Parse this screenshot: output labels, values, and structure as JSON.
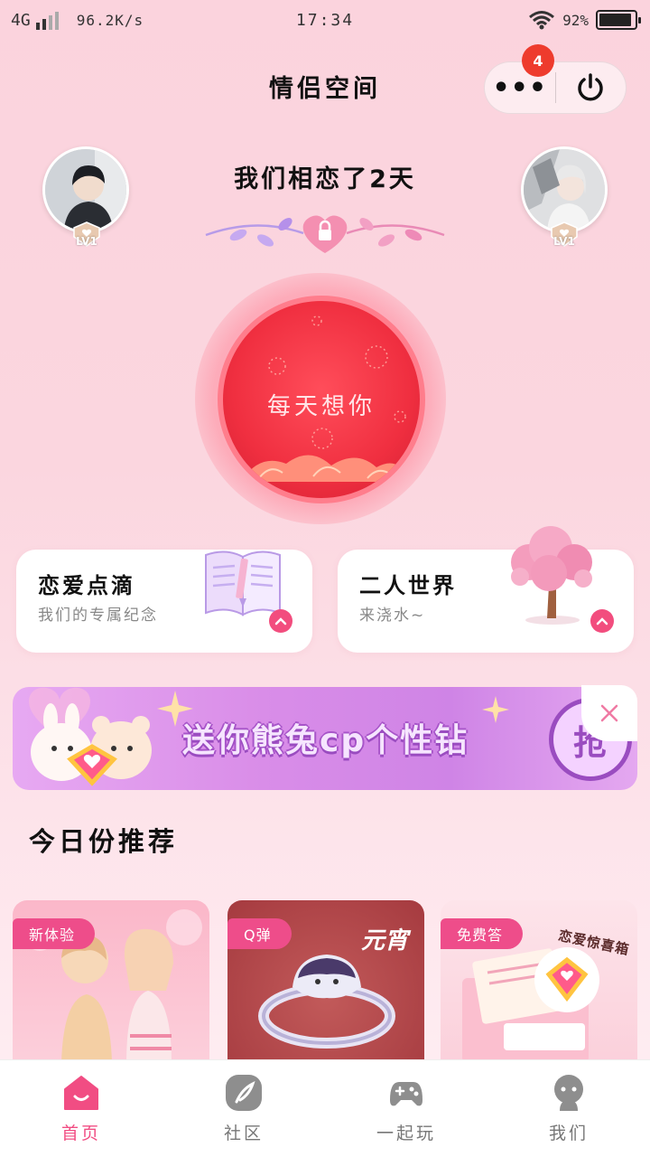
{
  "status_bar": {
    "network": "4G",
    "speed": "96.2K/s",
    "time": "17:34",
    "battery": "92%",
    "battery_level": 0.92
  },
  "header": {
    "title": "情侣空间",
    "notification_count": "4"
  },
  "couple": {
    "days_text": "我们相恋了2天",
    "left_level": "LV1",
    "right_level": "LV1"
  },
  "daily": {
    "label": "每天想你"
  },
  "cards": [
    {
      "title": "恋爱点滴",
      "subtitle": "我们的专属纪念"
    },
    {
      "title": "二人世界",
      "subtitle": "来浇水~"
    }
  ],
  "banner": {
    "text": "送你熊兔cp个性钻",
    "action": "抢"
  },
  "recommend": {
    "title": "今日份推荐",
    "items": [
      {
        "tag": "新体验"
      },
      {
        "tag": "Q弹",
        "art_text": "元宵"
      },
      {
        "tag": "免费答",
        "art_text": "恋爱惊喜箱"
      }
    ]
  },
  "tabbar": [
    {
      "label": "首页",
      "active": true
    },
    {
      "label": "社区"
    },
    {
      "label": "一起玩"
    },
    {
      "label": "我们"
    }
  ],
  "colors": {
    "accent": "#f14d83",
    "badge": "#ee3b2d",
    "circle": "#f02f40"
  }
}
